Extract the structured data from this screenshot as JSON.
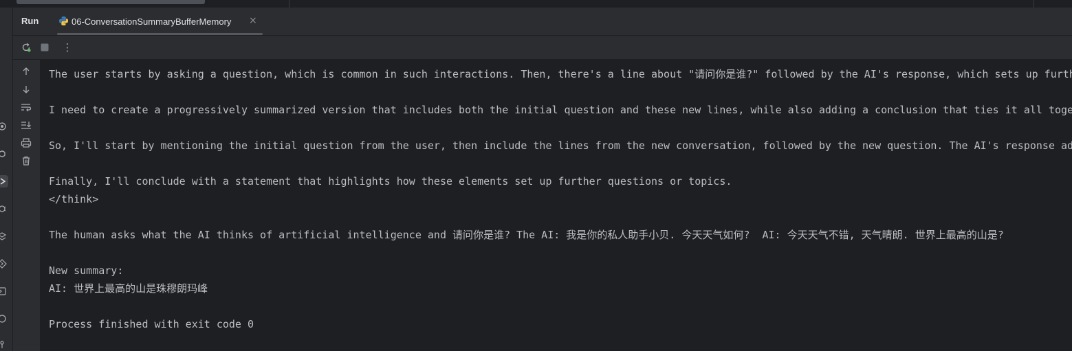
{
  "panel": {
    "title": "Run",
    "tab": {
      "label": "06-ConversationSummaryBufferMemory",
      "close_glyph": "×",
      "icon": "python-file-icon"
    }
  },
  "toolbar": {
    "rerun": {
      "icon": "rerun-icon"
    },
    "stop": {
      "icon": "stop-icon"
    },
    "more": {
      "glyph": "⋮",
      "icon": "more-options-icon"
    }
  },
  "side_actions": [
    {
      "name": "scroll-up-button",
      "icon": "arrow-up-icon"
    },
    {
      "name": "scroll-down-button",
      "icon": "arrow-down-icon"
    },
    {
      "name": "soft-wrap-button",
      "icon": "soft-wrap-icon"
    },
    {
      "name": "scroll-to-end-button",
      "icon": "scroll-to-end-icon"
    },
    {
      "name": "print-button",
      "icon": "print-icon"
    },
    {
      "name": "clear-all-button",
      "icon": "trash-icon"
    }
  ],
  "left_strip_icons": [
    "commit-icon",
    "python-packages-icon",
    "run-icon",
    "debug-icon",
    "layers-icon",
    "services-icon",
    "terminal-icon",
    "problems-icon",
    "git-icon"
  ],
  "console": {
    "lines": [
      "The user starts by asking a question, which is common in such interactions. Then, there's a line about \"请问你是谁?\" followed by the AI's response, which sets up furth",
      "",
      "I need to create a progressively summarized version that includes both the initial question and these new lines, while also adding a conclusion that ties it all toget",
      "",
      "So, I'll start by mentioning the initial question from the user, then include the lines from the new conversation, followed by the new question. The AI's response add",
      "",
      "Finally, I'll conclude with a statement that highlights how these elements set up further questions or topics.",
      "</think>",
      "",
      "The human asks what the AI thinks of artificial intelligence and 请问你是谁? The AI: 我是你的私人助手小贝. 今天天气如何?  AI: 今天天气不错, 天气晴朗. 世界上最高的山是?",
      "",
      "New summary:",
      "AI: 世界上最高的山是珠穆朗玛峰",
      "",
      "Process finished with exit code 0"
    ]
  },
  "colors": {
    "panel_bg": "#2b2d30",
    "console_bg": "#1e1f22",
    "text": "#bcbec4",
    "icon": "#a8abb2"
  }
}
